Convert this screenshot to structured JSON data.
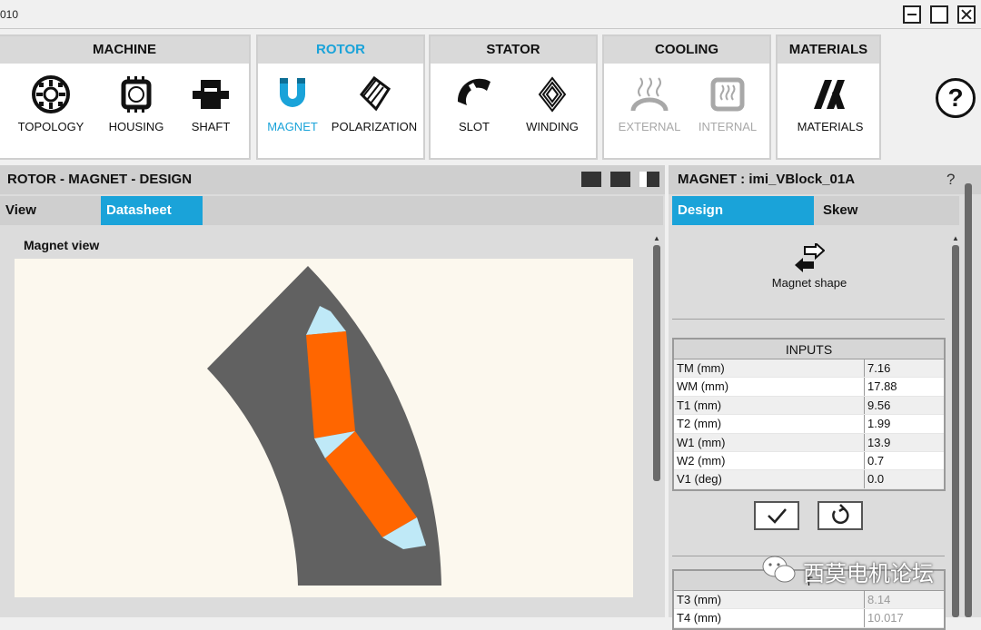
{
  "window": {
    "title": "010",
    "controls": [
      "minimize",
      "maximize",
      "close"
    ]
  },
  "ribbon": {
    "groups": [
      {
        "name": "MACHINE",
        "tools": [
          {
            "label": "TOPOLOGY",
            "icon": "topology-icon"
          },
          {
            "label": "HOUSING",
            "icon": "housing-icon"
          },
          {
            "label": "SHAFT",
            "icon": "shaft-icon"
          }
        ]
      },
      {
        "name": "ROTOR",
        "active": true,
        "tools": [
          {
            "label": "MAGNET",
            "icon": "magnet-icon",
            "active": true
          },
          {
            "label": "POLARIZATION",
            "icon": "polarization-icon"
          }
        ]
      },
      {
        "name": "STATOR",
        "tools": [
          {
            "label": "SLOT",
            "icon": "slot-icon"
          },
          {
            "label": "WINDING",
            "icon": "winding-icon"
          }
        ]
      },
      {
        "name": "COOLING",
        "tools": [
          {
            "label": "EXTERNAL",
            "icon": "external-cooling-icon",
            "disabled": true
          },
          {
            "label": "INTERNAL",
            "icon": "internal-cooling-icon",
            "disabled": true
          }
        ]
      },
      {
        "name": "MATERIALS",
        "tools": [
          {
            "label": "MATERIALS",
            "icon": "materials-icon"
          }
        ]
      }
    ],
    "help_label": "?"
  },
  "left": {
    "header": "ROTOR - MAGNET - DESIGN",
    "tabs": [
      "View",
      "Datasheet"
    ],
    "active_tab": "Datasheet",
    "view_label": "Magnet view"
  },
  "right": {
    "header": "MAGNET : imi_VBlock_01A",
    "help": "?",
    "tabs": [
      "Design",
      "Skew"
    ],
    "active_tab": "Design",
    "shape_label": "Magnet shape",
    "inputs_title": "INPUTS",
    "inputs": [
      {
        "k": "TM (mm)",
        "v": "7.16"
      },
      {
        "k": "WM (mm)",
        "v": "17.88"
      },
      {
        "k": "T1 (mm)",
        "v": "9.56"
      },
      {
        "k": "T2 (mm)",
        "v": "1.99"
      },
      {
        "k": "W1 (mm)",
        "v": "13.9"
      },
      {
        "k": "W2 (mm)",
        "v": "0.7"
      },
      {
        "k": "V1 (deg)",
        "v": "0.0"
      }
    ],
    "outputs_title": "T",
    "outputs": [
      {
        "k": "T3 (mm)",
        "v": "8.14"
      },
      {
        "k": "T4 (mm)",
        "v": "10.017"
      }
    ]
  },
  "watermark": "西莫电机论坛",
  "colors": {
    "accent": "#1aa3d9",
    "magnet": "#ff6600",
    "core": "#606060",
    "airgap": "#bfe9f7",
    "canvas": "#fcf8ee"
  }
}
